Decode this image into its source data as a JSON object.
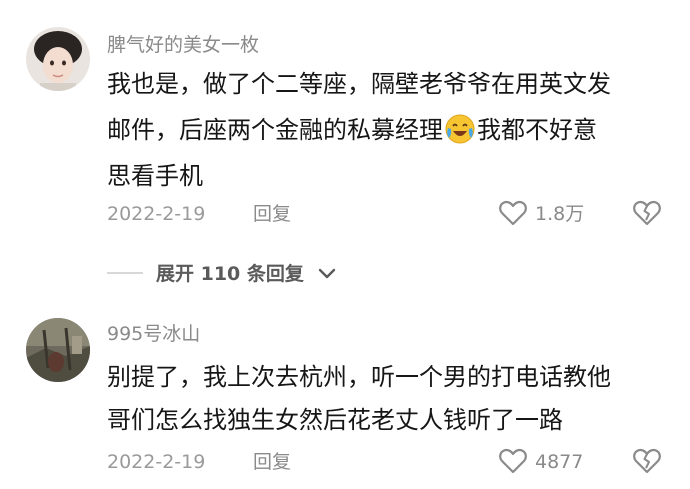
{
  "comments": [
    {
      "username": "脾气好的美女一枚",
      "lines": [
        "我也是，做了个二等座，隔壁老爷爷在用英文发",
        "邮件，后座两个金融的私募经理",
        "我都不好意",
        "思看手机"
      ],
      "emoji": "crying-laughing-emoji",
      "date": "2022-2-19",
      "reply_label": "回复",
      "likes": "1.8万"
    },
    {
      "username": "995号冰山",
      "lines": [
        "别提了，我上次去杭州，听一个男的打电话教他",
        "哥们怎么找独生女然后花老丈人钱听了一路"
      ],
      "date": "2022-2-19",
      "reply_label": "回复",
      "likes": "4877"
    }
  ],
  "expand_replies": "展开 110 条回复"
}
